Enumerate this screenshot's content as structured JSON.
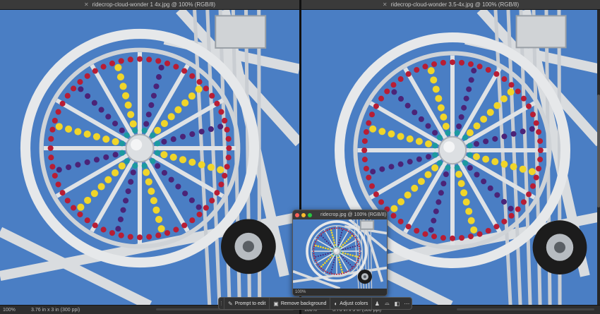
{
  "documents": [
    {
      "tab_title": "ridecrop-cloud-wonder 1 4x.jpg @ 100% (RGB/8)",
      "zoom": "100%",
      "dimensions": "3.76 in x 3 in (300 ppi)"
    },
    {
      "tab_title": "ridecrop-cloud-wonder 3.5-4x.jpg @ 100% (RGB/8)",
      "zoom": "100%",
      "dimensions": "3.76 in x 3 in (300 ppi)"
    }
  ],
  "floating_window": {
    "title": "ridecrop.jpg @ 100% (RGB/8)",
    "zoom": "100%"
  },
  "taskbar": {
    "prompt_to_edit": "Prompt to edit",
    "remove_background": "Remove background",
    "adjust_colors": "Adjust colors",
    "icons": [
      "drag-handle-icon",
      "sparkle-edit-icon",
      "remove-background-icon",
      "adjust-colors-icon",
      "person-icon",
      "transform-icon",
      "mask-icon",
      "more-icon"
    ]
  },
  "colors": {
    "sky": "#4a7ec4",
    "metal": "#e6e8ea",
    "red_bulb": "#b81d34",
    "purple_bulb": "#4b2377",
    "yellow_bulb": "#f0d52a",
    "teal_bulb": "#1c9aa0"
  }
}
